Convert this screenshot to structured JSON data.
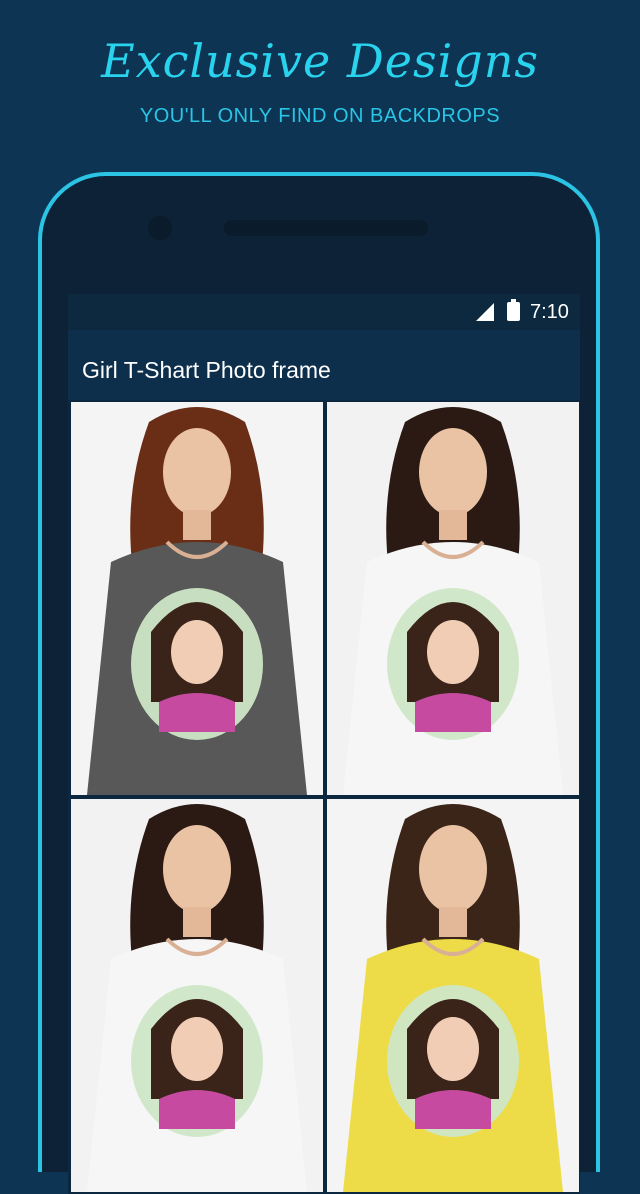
{
  "promo": {
    "headline": "Exclusive Designs",
    "tagline": "YOU'LL ONLY FIND ON BACKDROPS"
  },
  "status_bar": {
    "time": "7:10",
    "icons": [
      "cell-signal-icon",
      "battery-icon"
    ]
  },
  "app_bar": {
    "title": "Girl T-Shart Photo frame"
  },
  "frames": [
    {
      "name": "frame-grey-longsleeve",
      "shirt_color": "#585858",
      "bg_color": "#f4f4f4",
      "hair_color": "#6a2e16"
    },
    {
      "name": "frame-white-tee-biker",
      "shirt_color": "#f6f6f6",
      "bg_color": "#f2f2f2",
      "hair_color": "#2b1a14"
    },
    {
      "name": "frame-white-tee-santa",
      "shirt_color": "#f6f6f6",
      "bg_color": "#f2f2f2",
      "hair_color": "#2b1a14"
    },
    {
      "name": "frame-yellow-tee-flowers",
      "shirt_color": "#eddc48",
      "bg_color": "#f4f4f4",
      "hair_color": "#3b2418"
    }
  ],
  "colors": {
    "accent": "#29d3ee",
    "background": "#0d3452",
    "screen_bg": "#0b2840",
    "appbar_bg": "#0d2f4b"
  }
}
